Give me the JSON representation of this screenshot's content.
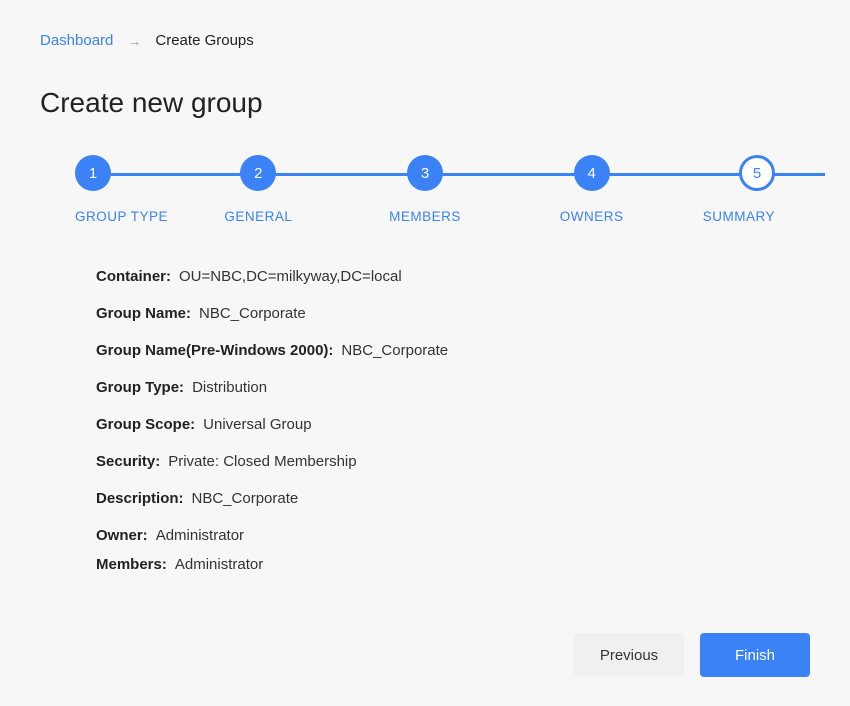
{
  "breadcrumb": {
    "root": "Dashboard",
    "current": "Create Groups"
  },
  "page_title": "Create new group",
  "stepper": {
    "steps": [
      {
        "num": "1",
        "label": "GROUP TYPE"
      },
      {
        "num": "2",
        "label": "GENERAL"
      },
      {
        "num": "3",
        "label": "MEMBERS"
      },
      {
        "num": "4",
        "label": "OWNERS"
      },
      {
        "num": "5",
        "label": "SUMMARY"
      }
    ]
  },
  "summary": {
    "container_label": "Container:",
    "container_value": "OU=NBC,DC=milkyway,DC=local",
    "group_name_label": "Group Name:",
    "group_name_value": "NBC_Corporate",
    "pre2000_label": "Group Name(Pre-Windows 2000):",
    "pre2000_value": "NBC_Corporate",
    "group_type_label": "Group Type:",
    "group_type_value": "Distribution",
    "group_scope_label": "Group Scope:",
    "group_scope_value": "Universal Group",
    "security_label": "Security:",
    "security_value": "Private: Closed Membership",
    "description_label": "Description:",
    "description_value": "NBC_Corporate",
    "owner_label": "Owner:",
    "owner_value": "Administrator",
    "members_label": "Members:",
    "members_value": "Administrator"
  },
  "buttons": {
    "previous": "Previous",
    "finish": "Finish"
  }
}
